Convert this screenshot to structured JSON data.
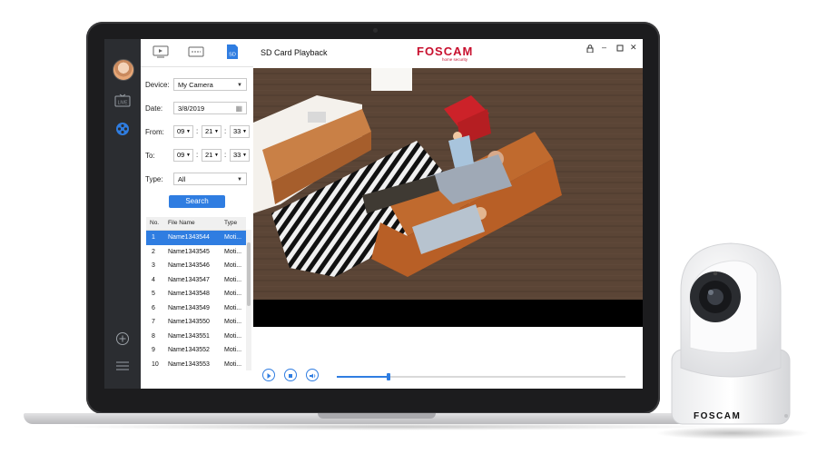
{
  "app": {
    "window_title": "SD Card Playback",
    "brand": "FOSCAM",
    "brand_tagline": "home security",
    "window_controls": [
      "lock-icon",
      "minimize-icon",
      "maximize-icon",
      "close-icon"
    ]
  },
  "rail": {
    "items": [
      {
        "name": "live-icon",
        "label": "LIVE"
      },
      {
        "name": "playback-reel-icon",
        "label": ""
      }
    ],
    "bottom": [
      "add-icon",
      "menu-icon"
    ]
  },
  "panel": {
    "tabs": [
      {
        "name": "tab-live-video",
        "icon": "monitor-icon"
      },
      {
        "name": "tab-nvr",
        "icon": "nvr-icon"
      },
      {
        "name": "tab-sd",
        "icon": "sd-card-icon",
        "label": "SD"
      }
    ],
    "form": {
      "device_label": "Device:",
      "device_value": "My Camera",
      "date_label": "Date:",
      "date_value": "3/8/2019",
      "from_label": "From:",
      "from_h": "09",
      "from_m": "21",
      "from_s": "33",
      "to_label": "To:",
      "to_h": "09",
      "to_m": "21",
      "to_s": "33",
      "type_label": "Type:",
      "type_value": "All",
      "search_label": "Search",
      "colon": ":"
    },
    "table": {
      "headers": [
        "No.",
        "File Name",
        "Type"
      ],
      "rows": [
        {
          "no": "1",
          "file": "Name1343544",
          "type": "Moti..."
        },
        {
          "no": "2",
          "file": "Name1343545",
          "type": "Moti..."
        },
        {
          "no": "3",
          "file": "Name1343546",
          "type": "Moti..."
        },
        {
          "no": "4",
          "file": "Name1343547",
          "type": "Moti..."
        },
        {
          "no": "5",
          "file": "Name1343548",
          "type": "Moti..."
        },
        {
          "no": "6",
          "file": "Name1343549",
          "type": "Moti..."
        },
        {
          "no": "7",
          "file": "Name1343550",
          "type": "Moti..."
        },
        {
          "no": "8",
          "file": "Name1343551",
          "type": "Moti..."
        },
        {
          "no": "9",
          "file": "Name1343552",
          "type": "Moti..."
        },
        {
          "no": "10",
          "file": "Name1343553",
          "type": "Moti..."
        }
      ],
      "selected_row": 1
    }
  },
  "player": {
    "controls": [
      "play-icon",
      "stop-icon",
      "volume-icon"
    ],
    "progress_fraction": 0.18
  },
  "camera_device": {
    "brand": "FOSCAM"
  },
  "colors": {
    "accent": "#2f7de1",
    "brand": "#c8102e",
    "rail_bg": "#2b2d31"
  }
}
